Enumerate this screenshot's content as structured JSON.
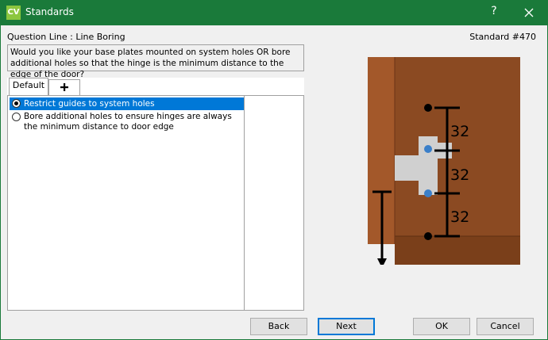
{
  "window": {
    "app_icon_text": "CV",
    "title": "Standards",
    "help_label": "?"
  },
  "header": {
    "question_line": "Question Line : Line Boring",
    "standard_number": "Standard #470"
  },
  "question": {
    "text": "Would you like your base plates mounted on system holes OR bore additional holes so that the hinge is the minimum distance to the edge of the door?"
  },
  "tabs": [
    {
      "label": "Default",
      "selected": true
    },
    {
      "label": "+",
      "icon": "plus-icon"
    }
  ],
  "options": [
    {
      "label": "Restrict guides to system holes",
      "selected": true
    },
    {
      "label": "Bore additional holes to ensure hinges are always the minimum distance to door edge",
      "selected": false
    }
  ],
  "illustration": {
    "dimension_labels": [
      "32",
      "32",
      "32"
    ],
    "colors": {
      "cabinet": "#8b4a22",
      "cabinet_bottom": "#7a3f1a",
      "door_edge": "#a3582a",
      "hinge_plate": "#d0d0d0",
      "hole": "#3a7fc9",
      "dimension_line": "#000000"
    }
  },
  "buttons": {
    "back": "Back",
    "next": "Next",
    "ok": "OK",
    "cancel": "Cancel"
  },
  "colors": {
    "titlebar": "#1a7a3a",
    "selection": "#0078d7"
  }
}
